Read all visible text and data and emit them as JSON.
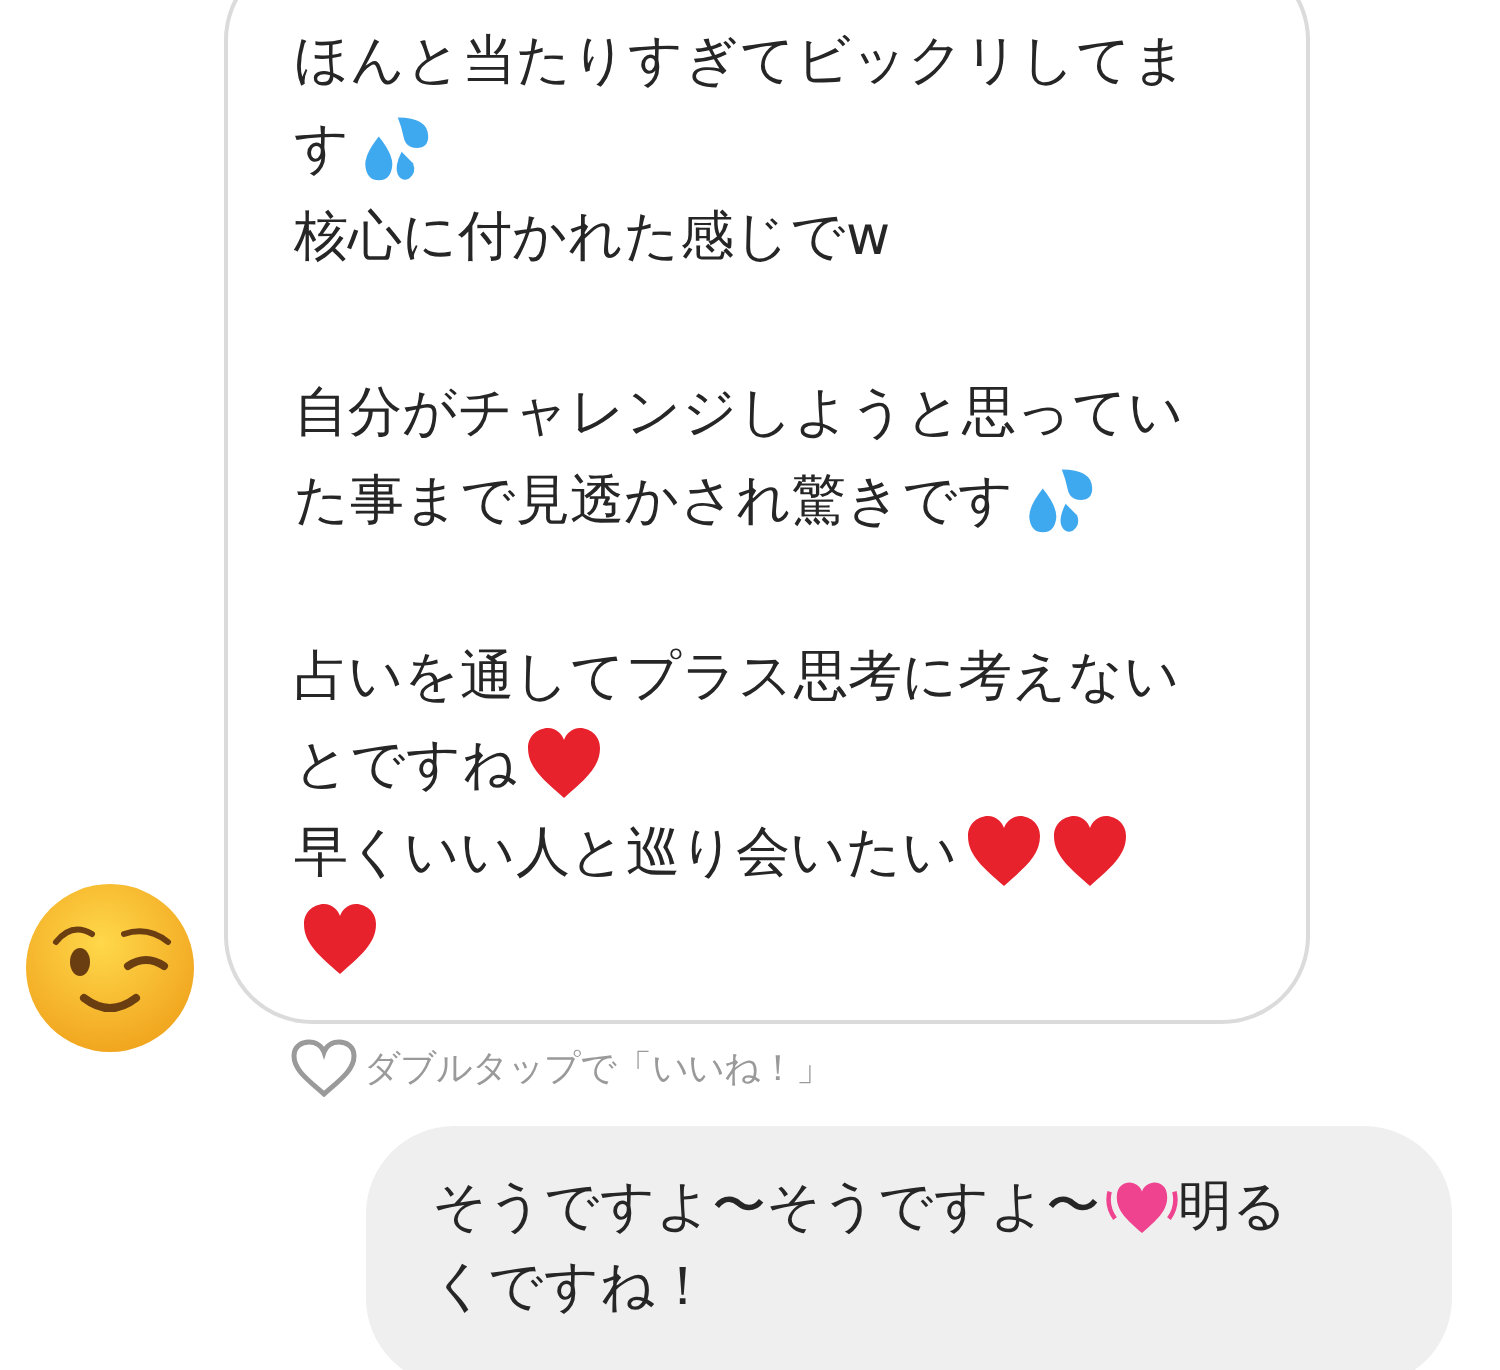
{
  "received_message": {
    "paragraphs": [
      [
        [
          {
            "kind": "text",
            "text": "ほんと当たりすぎてビックリしてま"
          }
        ],
        [
          {
            "kind": "text",
            "text": "す"
          },
          {
            "kind": "droplets"
          }
        ],
        [
          {
            "kind": "text",
            "text": "核心に付かれた感じでw"
          }
        ]
      ],
      [
        [
          {
            "kind": "text",
            "text": "自分がチャレンジしようと思ってい"
          }
        ],
        [
          {
            "kind": "text",
            "text": "た事まで見透かされ驚きです"
          },
          {
            "kind": "droplets"
          }
        ]
      ],
      [
        [
          {
            "kind": "text",
            "text": "占いを通してプラス思考に考えない"
          }
        ],
        [
          {
            "kind": "text",
            "text": "とですね"
          },
          {
            "kind": "heart"
          }
        ],
        [
          {
            "kind": "text",
            "text": "早くいい人と巡り会いたい"
          },
          {
            "kind": "heart"
          },
          {
            "kind": "heart"
          }
        ],
        [
          {
            "kind": "heart"
          }
        ]
      ]
    ]
  },
  "like_hint": "ダブルタップで「いいね！」",
  "sent_message": {
    "lines": [
      [
        {
          "kind": "text",
          "text": "そうですよ〜そうですよ〜"
        },
        {
          "kind": "beating-heart"
        },
        {
          "kind": "text",
          "text": "明る"
        }
      ],
      [
        {
          "kind": "text",
          "text": "くですね！"
        }
      ]
    ]
  }
}
